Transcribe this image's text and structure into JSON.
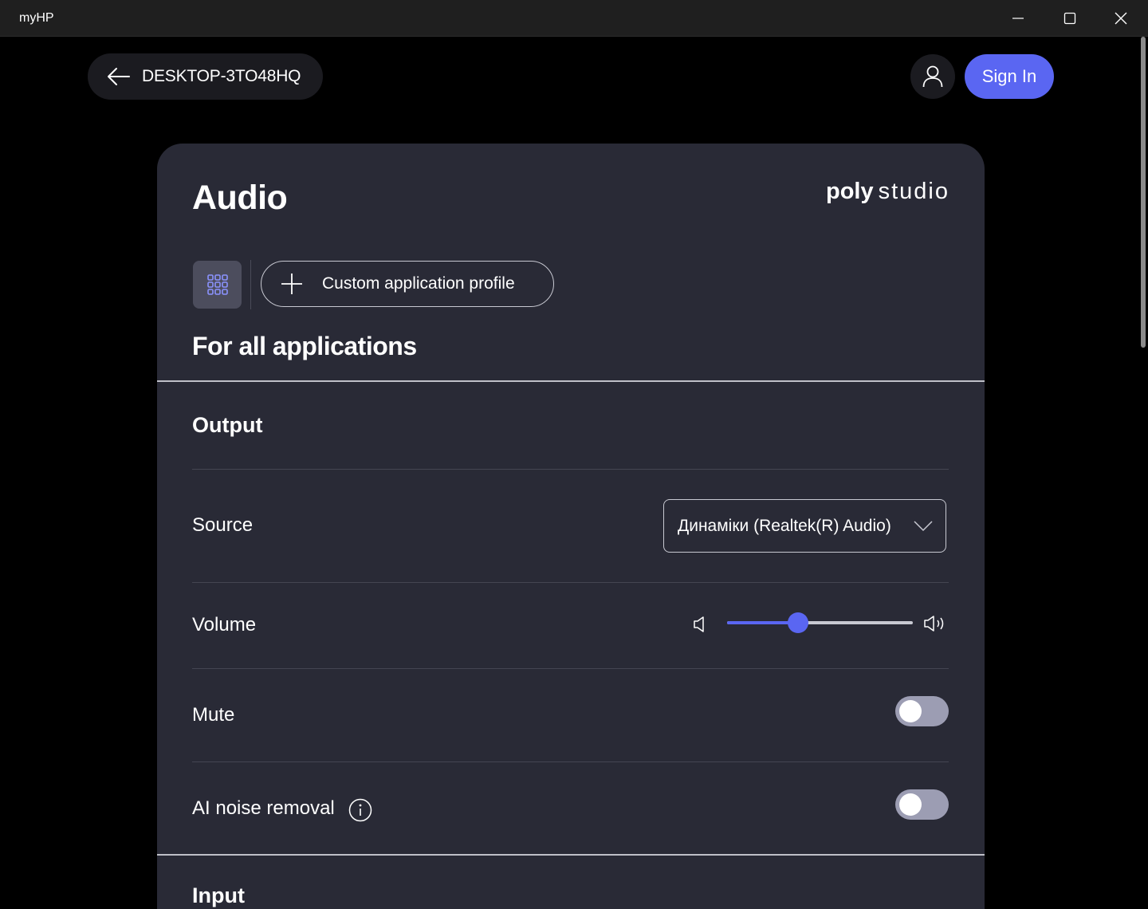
{
  "window": {
    "title": "myHP",
    "controls": [
      "minimize-icon",
      "maximize-icon",
      "close-icon"
    ]
  },
  "header": {
    "device_name": "DESKTOP-3TO48HQ",
    "back_icon": "arrow-left-icon",
    "account_icon": "user-icon",
    "sign_in_label": "Sign In"
  },
  "card": {
    "title": "Audio",
    "brand": {
      "bold": "poly",
      "light": "studio"
    },
    "profiles_icon": "grid-icon",
    "add_profile_label": "Custom application profile",
    "section_title": "For all applications",
    "output": {
      "title": "Output",
      "source_label": "Source",
      "source_value": "Динаміки (Realtek(R) Audio)",
      "volume_label": "Volume",
      "volume_level": 0.38,
      "mute_label": "Mute",
      "mute_on": false,
      "noise_label": "AI noise removal",
      "noise_on": false
    },
    "next_section_title": "Input"
  },
  "colors": {
    "accent": "#5a66f2",
    "card_bg": "#292a36",
    "toggle_off": "#9c9db3"
  }
}
